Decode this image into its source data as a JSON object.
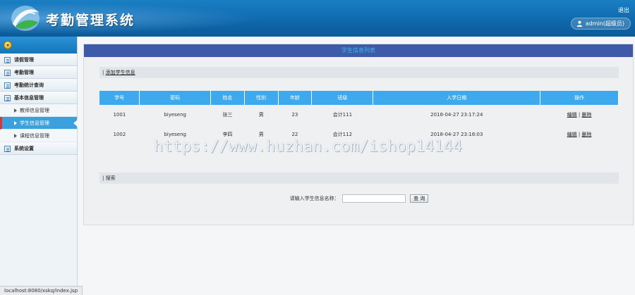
{
  "header": {
    "app_title": "考勤管理系统",
    "logout_label": "退出",
    "user_label": "admin(超级员)"
  },
  "sidebar": {
    "items": [
      {
        "label": "请假管理"
      },
      {
        "label": "考勤管理"
      },
      {
        "label": "考勤统计查询"
      },
      {
        "label": "基本信息管理",
        "children": [
          {
            "label": "教师信息管理"
          },
          {
            "label": "学生信息管理",
            "active": true
          },
          {
            "label": "课程信息管理"
          }
        ]
      },
      {
        "label": "系统设置"
      }
    ]
  },
  "main": {
    "panel_title": "学生信息列表",
    "add_link": "添加学生信息",
    "table": {
      "headers": [
        "学号",
        "密码",
        "姓名",
        "性别",
        "年龄",
        "班级",
        "入学日期",
        "操作"
      ],
      "rows": [
        {
          "id": "1001",
          "password": "biyeseng",
          "name": "张三",
          "gender": "男",
          "age": "23",
          "class": "会计111",
          "date": "2018-04-27 23:17:24",
          "edit": "编辑",
          "delete": "删除"
        },
        {
          "id": "1002",
          "password": "biyeseng",
          "name": "李四",
          "gender": "男",
          "age": "22",
          "class": "会计112",
          "date": "2018-04-27 23:18:03",
          "edit": "编辑",
          "delete": "删除"
        }
      ]
    },
    "search_section": "搜索",
    "search_label": "请输入学生信息名称：",
    "search_value": "",
    "search_button": "查 询"
  },
  "watermark": "https://www.huzhan.com/ishop14144",
  "statusbar": "localhost:8080/xskq/index.jsp",
  "colors": {
    "header_blue": "#1277bf",
    "panel_title_bg": "#3f5aa8",
    "table_header": "#3fa9ee",
    "active_item": "#3aa1dc"
  }
}
